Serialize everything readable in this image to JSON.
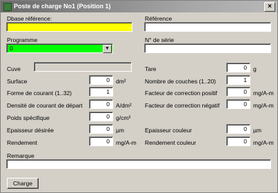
{
  "window": {
    "title": "Poste de charge No1 (Position 1)",
    "close_glyph": "×"
  },
  "labels": {
    "dbase_reference": "Dbase référence:",
    "reference": "Référence",
    "programme": "Programme",
    "serial": "N° de série",
    "cuve": "Cuve",
    "tare": "Tare",
    "surface": "Surface",
    "nb_couches": "Nombre de couches (1..20)",
    "forme_courant": "Forme de courant (1..32)",
    "facteur_pos": "Facteur de correction positif",
    "densite": "Densité de courant de départ",
    "facteur_neg": "Facteur de correction négatif",
    "poids": "Poids spécifique",
    "epaisseur_desiree": "Epaisseur désirée",
    "epaisseur_couleur": "Epaisseur couleur",
    "rendement": "Rendement",
    "rendement_couleur": "Rendement couleur",
    "remarque": "Remarque"
  },
  "units": {
    "tare": "g",
    "surface": "dm²",
    "facteur_pos": "mg/A-m",
    "densite": "A/dm²",
    "facteur_neg": "mg/A-m",
    "poids": "g/cm³",
    "epaisseur_desiree": "µm",
    "epaisseur_couleur": "µm",
    "rendement": "mg/A-m",
    "rendement_couleur": "mg/A-m"
  },
  "values": {
    "dbase_reference": "",
    "reference": "",
    "programme": "0",
    "serial": "",
    "cuve": "",
    "tare": "0",
    "surface": "0",
    "nb_couches": "1",
    "forme_courant": "1",
    "facteur_pos": "0",
    "densite": "0",
    "facteur_neg": "0",
    "poids": "0",
    "epaisseur_desiree": "0",
    "epaisseur_couleur": "0",
    "rendement": "0",
    "rendement_couleur": "0",
    "remarque": ""
  },
  "buttons": {
    "charge": "Charge"
  },
  "colors": {
    "dbase_field": "#ffff00",
    "programme_field": "#00ff00"
  }
}
